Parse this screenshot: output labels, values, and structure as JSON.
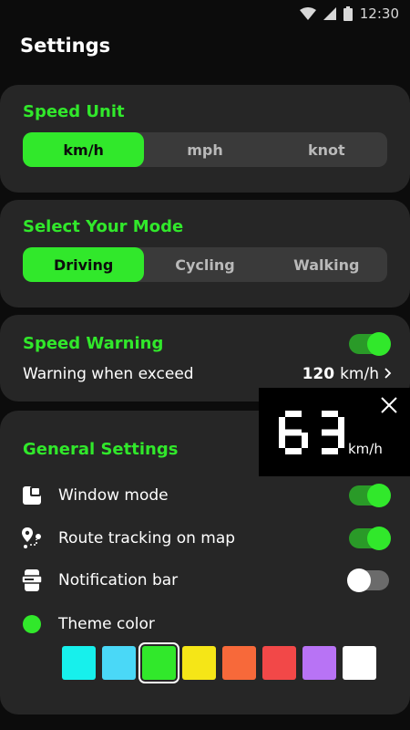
{
  "status_bar": {
    "time": "12:30"
  },
  "page": {
    "title": "Settings"
  },
  "speed_unit": {
    "title": "Speed Unit",
    "options": [
      "km/h",
      "mph",
      "knot"
    ],
    "selected": "km/h"
  },
  "mode": {
    "title": "Select Your Mode",
    "options": [
      "Driving",
      "Cycling",
      "Walking"
    ],
    "selected": "Driving"
  },
  "speed_warning": {
    "title": "Speed Warning",
    "enabled": true,
    "row_label": "Warning when exceed",
    "value": "120",
    "unit": "km/h"
  },
  "general": {
    "title": "General Settings",
    "items": [
      {
        "label": "Window mode",
        "icon": "window-icon",
        "enabled": true
      },
      {
        "label": "Route tracking on map",
        "icon": "route-icon",
        "enabled": true
      },
      {
        "label": "Notification bar",
        "icon": "phone-notification-icon",
        "enabled": false
      }
    ],
    "theme_label": "Theme color",
    "theme_current": "#31e82b",
    "theme_colors": [
      "#17f0ec",
      "#4ad8f7",
      "#31e82b",
      "#f5e617",
      "#f7693a",
      "#f24848",
      "#b873f5",
      "#ffffff"
    ],
    "theme_selected_index": 2
  },
  "floating_widget": {
    "speed": "63",
    "unit": "km/h"
  },
  "colors": {
    "accent": "#31e82b",
    "card": "#262626",
    "background": "#0c0c0c"
  }
}
